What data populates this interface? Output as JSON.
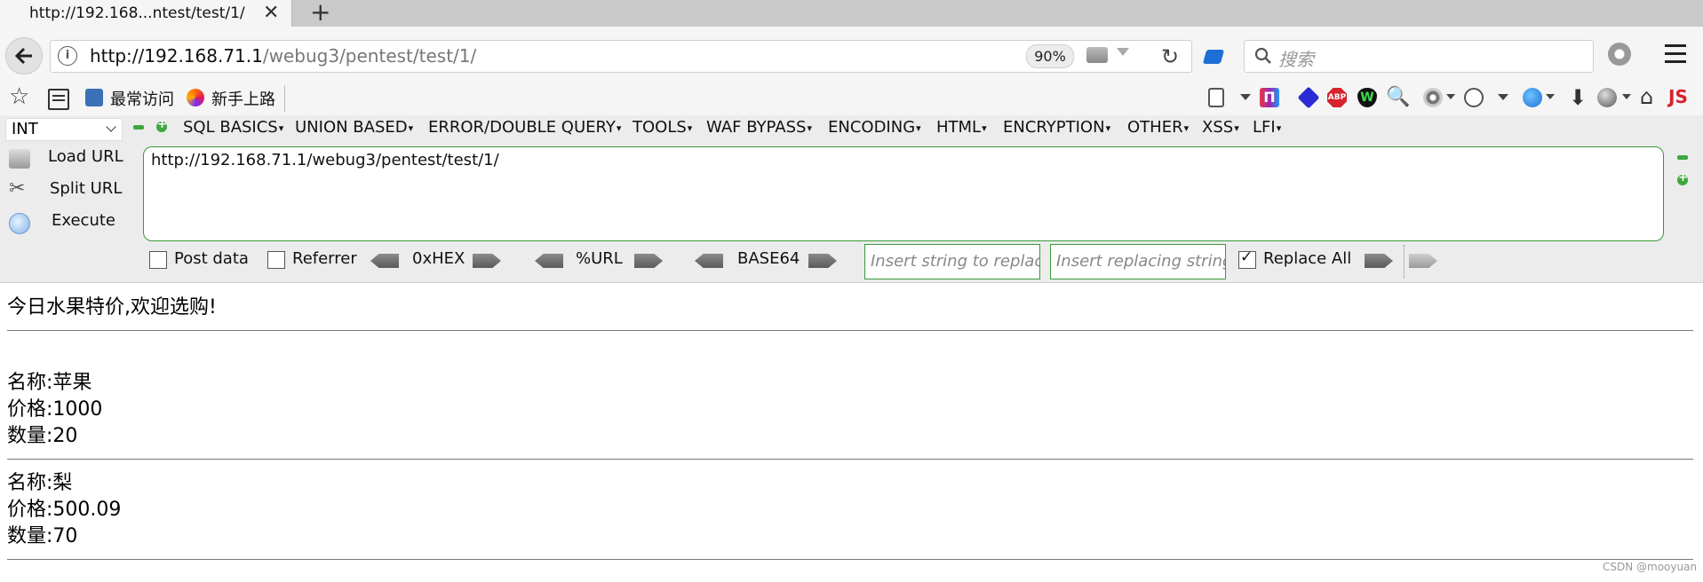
{
  "tab": {
    "title": "http://192.168...ntest/test/1/",
    "new_tab_glyph": "+",
    "close_glyph": "✕"
  },
  "navbar": {
    "url_host": "http://192.168.71.1",
    "url_path": "/webug3/pentest/test/1/",
    "zoom": "90%",
    "search_placeholder": "搜索",
    "reload_glyph": "↻"
  },
  "bookmarks": {
    "items": [
      {
        "label": "最常访问"
      },
      {
        "label": "新手上路"
      }
    ]
  },
  "extensions": {
    "icons": [
      "page-copy-icon",
      "hackbar-icon",
      "layers-icon",
      "adblock-plus-icon",
      "wot-shield-icon",
      "inspector-icon",
      "radar-icon",
      "cookie-icon",
      "translate-icon",
      "download-icon",
      "disk-icon",
      "home-icon",
      "js-icon"
    ],
    "abp_text": "ABP",
    "js_text": "JS",
    "hb_text": "П"
  },
  "hackbar": {
    "type_select": "INT",
    "menus": [
      "SQL BASICS",
      "UNION BASED",
      "ERROR/DOUBLE QUERY",
      "TOOLS",
      "WAF BYPASS",
      "ENCODING",
      "HTML",
      "ENCRYPTION",
      "OTHER",
      "XSS",
      "LFI"
    ],
    "load_url": "Load URL",
    "split_url": "Split URL",
    "execute": "Execute",
    "url_value": "http://192.168.71.1/webug3/pentest/test/1/",
    "post_data": "Post data",
    "referrer": "Referrer",
    "hex": "0xHEX",
    "url_enc": "%URL",
    "base64": "BASE64",
    "insert_string_placeholder": "Insert string to replace",
    "insert_replacing_placeholder": "Insert replacing string",
    "replace_all": "Replace All",
    "replace_all_checked": true,
    "post_data_checked": false,
    "referrer_checked": false
  },
  "page": {
    "heading": "今日水果特价,欢迎选购!",
    "products": [
      {
        "name": "名称:苹果",
        "price": "价格:1000",
        "quantity": "数量:20"
      },
      {
        "name": "名称:梨",
        "price": "价格:500.09",
        "quantity": "数量:70"
      }
    ]
  },
  "watermark": "CSDN @mooyuan",
  "colors": {
    "accent_green": "#3a9a3a",
    "pocket_blue": "#1d6fd6",
    "abp_red": "#d8212b"
  }
}
